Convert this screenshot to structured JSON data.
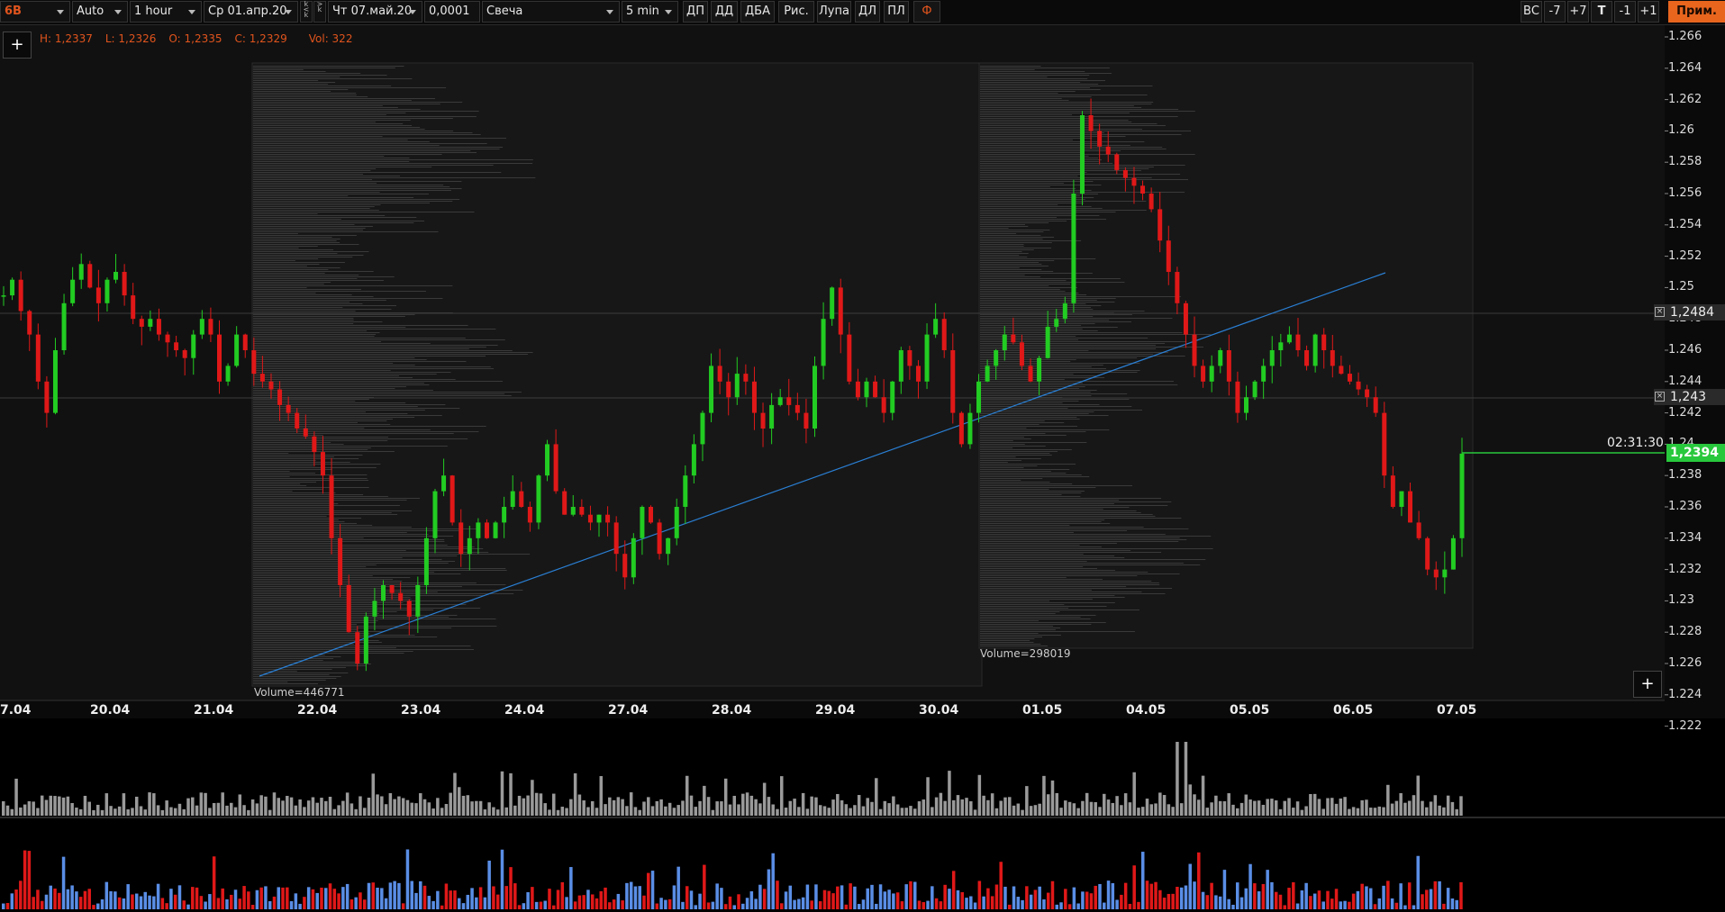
{
  "toolbar": {
    "symbol": "6B",
    "scale_mode": "Auto",
    "timeframe": "1 hour",
    "date_from": "Ср 01.апр.20",
    "date_to": "Чт 07.май.20",
    "tick_size": "0,0001",
    "chart_style": "Свеча",
    "profile_tf": "5 min",
    "buttons": [
      "ДП",
      "ДД",
      "ДБА",
      "Рис.",
      "Лупа",
      "ДЛ",
      "ПЛ"
    ],
    "settings_icon": "Ф",
    "right_buttons": [
      "ВС",
      "-7",
      "+7",
      "T",
      "-1",
      "+1"
    ],
    "apply": "Прим."
  },
  "ohlc": {
    "h": "H: 1,2337",
    "l": "L: 1,2326",
    "o": "O: 1,2335",
    "c": "C: 1,2329",
    "vol": "Vol: 322"
  },
  "price_axis": [
    "1.266",
    "1.264",
    "1.262",
    "1.26",
    "1.258",
    "1.256",
    "1.254",
    "1.252",
    "1.25",
    "1.248",
    "1.246",
    "1.244",
    "1.242",
    "1.24",
    "1.238",
    "1.236",
    "1.234",
    "1.232",
    "1.23",
    "1.228",
    "1.226",
    "1.224",
    "1.222"
  ],
  "levels": {
    "upper": "1,2484",
    "lower": "1,243"
  },
  "current_price": "1,2394",
  "countdown": "02:31:30",
  "volume_profiles": {
    "first": "Volume=446771",
    "second": "Volume=298019"
  },
  "dates": [
    "7.04",
    "20.04",
    "21.04",
    "22.04",
    "23.04",
    "24.04",
    "27.04",
    "28.04",
    "29.04",
    "30.04",
    "01.05",
    "04.05",
    "05.05",
    "06.05",
    "07.05"
  ],
  "colors": {
    "up": "#22cc22",
    "down": "#e01818",
    "trend": "#2a7fd4",
    "accent": "#e8651e",
    "delta_pos": "#5a8ee6",
    "delta_neg": "#e01818"
  },
  "chart_data": {
    "type": "candlestick",
    "series": [
      {
        "name": "6B",
        "ohlc_hourly_approx": [
          1.2495,
          1.2505,
          1.2485,
          1.247,
          1.244,
          1.242,
          1.246,
          1.249,
          1.2505,
          1.2515,
          1.25,
          1.249,
          1.2505,
          1.251,
          1.2495,
          1.248,
          1.2475,
          1.248,
          1.247,
          1.2465,
          1.246,
          1.2455,
          1.247,
          1.248,
          1.247,
          1.244,
          1.245,
          1.247,
          1.246,
          1.2445,
          1.244,
          1.2435,
          1.2425,
          1.242,
          1.241,
          1.2405,
          1.2395,
          1.238,
          1.234,
          1.231,
          1.228,
          1.226,
          1.229,
          1.23,
          1.231,
          1.2305,
          1.23,
          1.229,
          1.231,
          1.234,
          1.237,
          1.238,
          1.235,
          1.233,
          1.234,
          1.235,
          1.234,
          1.235,
          1.236,
          1.237,
          1.236,
          1.235,
          1.238,
          1.24,
          1.237,
          1.2355,
          1.236,
          1.2355,
          1.235,
          1.2355,
          1.235,
          1.233,
          1.2315,
          1.234,
          1.236,
          1.235,
          1.233,
          1.234,
          1.236,
          1.238,
          1.24,
          1.242,
          1.245,
          1.244,
          1.243,
          1.2445,
          1.244,
          1.242,
          1.241,
          1.2425,
          1.243,
          1.2425,
          1.242,
          1.241,
          1.245,
          1.248,
          1.25,
          1.247,
          1.244,
          1.243,
          1.244,
          1.243,
          1.242,
          1.244,
          1.246,
          1.245,
          1.244,
          1.247,
          1.248,
          1.246,
          1.242,
          1.24,
          1.242,
          1.244,
          1.245,
          1.246,
          1.247,
          1.2465,
          1.245,
          1.244,
          1.2455,
          1.2475,
          1.248,
          1.249,
          1.256,
          1.261,
          1.26,
          1.259,
          1.2585,
          1.2575,
          1.257,
          1.2565,
          1.256,
          1.255,
          1.253,
          1.251,
          1.249,
          1.247,
          1.245,
          1.244,
          1.245,
          1.246,
          1.244,
          1.242,
          1.243,
          1.244,
          1.245,
          1.246,
          1.2465,
          1.247,
          1.246,
          1.245,
          1.247,
          1.246,
          1.245,
          1.2445,
          1.244,
          1.2435,
          1.243,
          1.242,
          1.238,
          1.236,
          1.237,
          1.235,
          1.234,
          1.232,
          1.2315,
          1.232,
          1.234,
          1.2394
        ]
      }
    ],
    "ylim": [
      1.222,
      1.266
    ],
    "x_categories": [
      "7.04",
      "20.04",
      "21.04",
      "22.04",
      "23.04",
      "24.04",
      "27.04",
      "28.04",
      "29.04",
      "30.04",
      "01.05",
      "04.05",
      "05.05",
      "06.05",
      "07.05"
    ],
    "grid": false
  }
}
